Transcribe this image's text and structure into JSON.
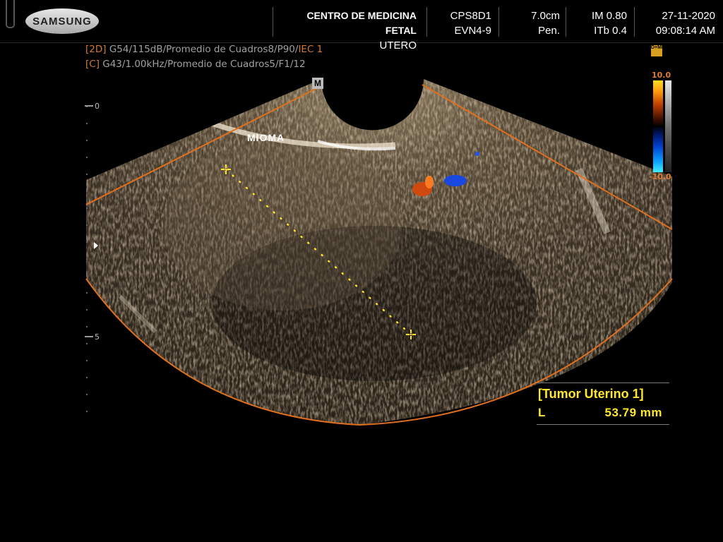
{
  "header": {
    "brand": "SAMSUNG",
    "institution": "CENTRO DE MEDICINA FETAL",
    "exam": "UTERO",
    "probe": "CPS8D1",
    "preset": "EVN4-9",
    "depth": "7.0cm",
    "mode": "Pen.",
    "mi": "IM 0.80",
    "tib": "ITb 0.4",
    "date": "27-11-2020",
    "time": "09:08:14 AM"
  },
  "params": {
    "line1_tag": "[2D]",
    "line1": " G54/115dB/Promedio de Cuadros8/P90/",
    "line1_suffix": "IEC 1",
    "line2_tag": "[C]",
    "line2": " G43/1.00kHz/Promedio de Cuadros5/F1/12"
  },
  "colorbar": {
    "top": "10.0",
    "bottom": "-10.0",
    "icon": "D+MR"
  },
  "scale": {
    "zero": "0",
    "five": "5"
  },
  "image": {
    "annotation": "MIOMA",
    "marker": "M"
  },
  "measurement": {
    "title": "[Tumor Uterino 1]",
    "param": "L",
    "value": "53.79 mm"
  },
  "colors": {
    "measure": "#ffe62a",
    "roi": "#e07020",
    "tag": "#d07a3a"
  }
}
